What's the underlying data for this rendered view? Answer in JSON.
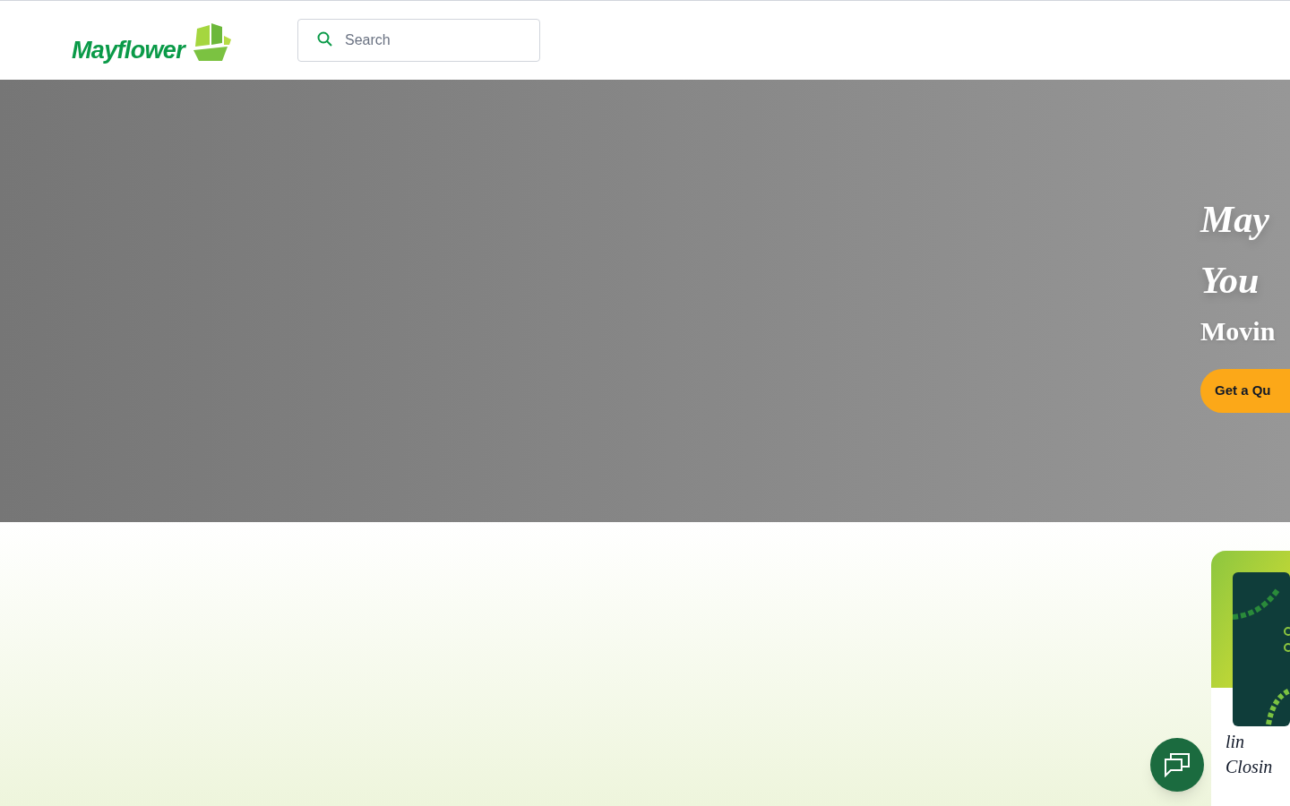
{
  "header": {
    "logo": "Mayflower",
    "search": {
      "placeholder": "Search"
    }
  },
  "hero": {
    "title_lines": [
      "May",
      "You"
    ],
    "subtitle": "Movin",
    "button": "Get a Qu"
  },
  "card": {
    "title_lines": [
      "lin",
      "Closin"
    ]
  }
}
